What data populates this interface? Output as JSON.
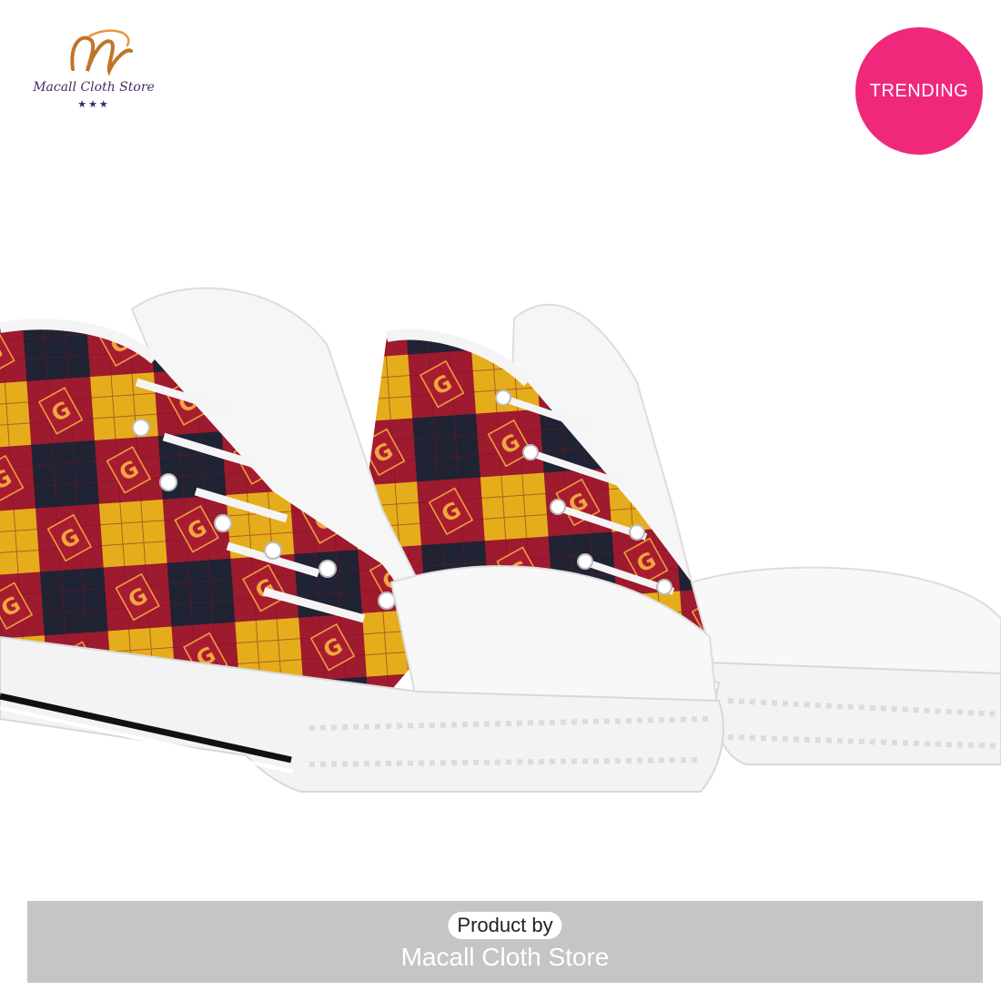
{
  "brand": {
    "logo_text": "Macall Cloth Store",
    "stars": "★★★"
  },
  "badge": {
    "label": "TRENDING",
    "color": "#f0287c"
  },
  "footer": {
    "product_by": "Product by",
    "store_name": "Macall Cloth Store"
  },
  "product": {
    "pattern_letter": "G",
    "colors": {
      "maroon": "#9e1a2e",
      "gold": "#e5ad1c",
      "navy": "#1f2333",
      "white": "#f4f4f4"
    }
  }
}
